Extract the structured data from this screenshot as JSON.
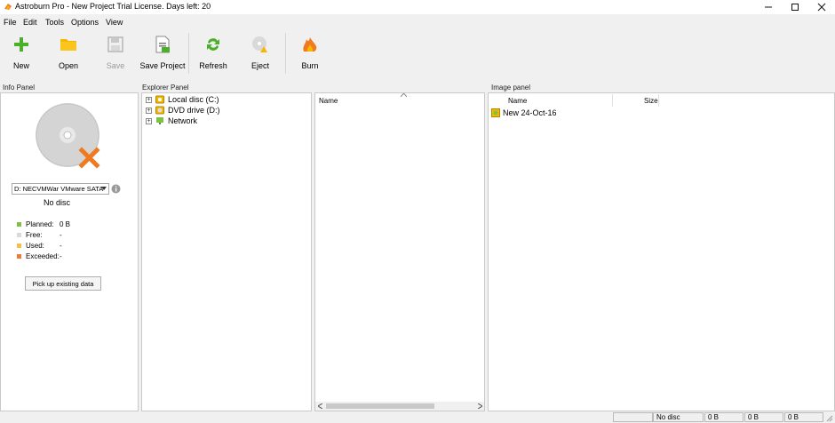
{
  "window": {
    "title": "Astroburn Pro - New Project  Trial License. Days left: 20"
  },
  "menu": [
    {
      "label": "File"
    },
    {
      "label": "Edit"
    },
    {
      "label": "Tools"
    },
    {
      "label": "Options"
    },
    {
      "label": "View"
    }
  ],
  "toolbar": {
    "new": "New",
    "open": "Open",
    "save": "Save",
    "save_project": "Save Project",
    "refresh": "Refresh",
    "eject": "Eject",
    "burn": "Burn"
  },
  "panels": {
    "info": "Info Panel",
    "explorer": "Explorer Panel",
    "image": "Image panel"
  },
  "info": {
    "drive_select": "D: NECVMWar VMware SATA",
    "disc_status": "No disc",
    "legend": [
      {
        "label": "Planned:",
        "value": "0 B",
        "color": "#7dc242"
      },
      {
        "label": "Free:",
        "value": "-",
        "color": "#d9d9d9"
      },
      {
        "label": "Used:",
        "value": "-",
        "color": "#f0c04a"
      },
      {
        "label": "Exceeded:",
        "value": "-",
        "color": "#ee7a3a"
      }
    ],
    "pickup_button": "Pick up existing data"
  },
  "explorer": {
    "tree": [
      {
        "label": "Local disc (C:)",
        "icon": "hard-drive-icon"
      },
      {
        "label": "DVD drive (D:)",
        "icon": "dvd-drive-icon"
      },
      {
        "label": "Network",
        "icon": "network-icon"
      }
    ],
    "list_header": "Name"
  },
  "image": {
    "columns": {
      "name": "Name",
      "size": "Size"
    },
    "items": [
      {
        "label": "New 24-Oct-16",
        "icon": "disc-image-icon"
      }
    ]
  },
  "status": {
    "disc": "No disc",
    "cell2": "0 B",
    "cell3": "0 B",
    "cell4": "0 B"
  },
  "colors": {
    "accent_green": "#4caf2a",
    "folder": "#f5b800",
    "burn": "#f07a1f"
  }
}
